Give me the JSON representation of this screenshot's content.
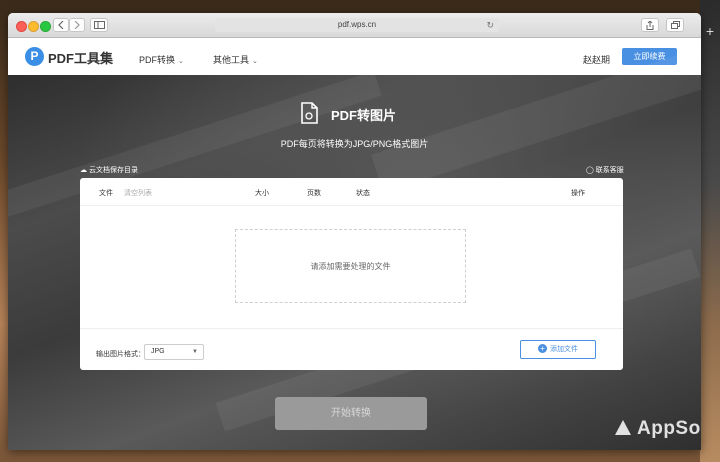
{
  "browser": {
    "url": "pdf.wps.cn"
  },
  "nav": {
    "logo_letter": "P",
    "logo_text": "PDF工具集",
    "items": [
      {
        "label": "PDF转换"
      },
      {
        "label": "其他工具"
      }
    ],
    "user_name": "赵赵期",
    "renew_label": "立即续费"
  },
  "hero": {
    "title": "PDF转图片",
    "subtitle": "PDF每页将转换为JPG/PNG格式图片",
    "cloud_link": "云文档保存目录",
    "support_link": "联系客服"
  },
  "table": {
    "headers": {
      "file": "文件",
      "clear": "清空列表",
      "size": "大小",
      "pages": "页数",
      "status": "状态",
      "action": "操作"
    },
    "dropzone_text": "请添加需要处理的文件"
  },
  "options": {
    "format_label": "输出图片格式：",
    "format_value": "JPG",
    "add_file_label": "添加文件"
  },
  "start_label": "开始转换",
  "watermark": "AppSo",
  "colors": {
    "accent": "#4a90e2",
    "logo": "#3a8ee6",
    "start_disabled": "#9a9a9a"
  }
}
